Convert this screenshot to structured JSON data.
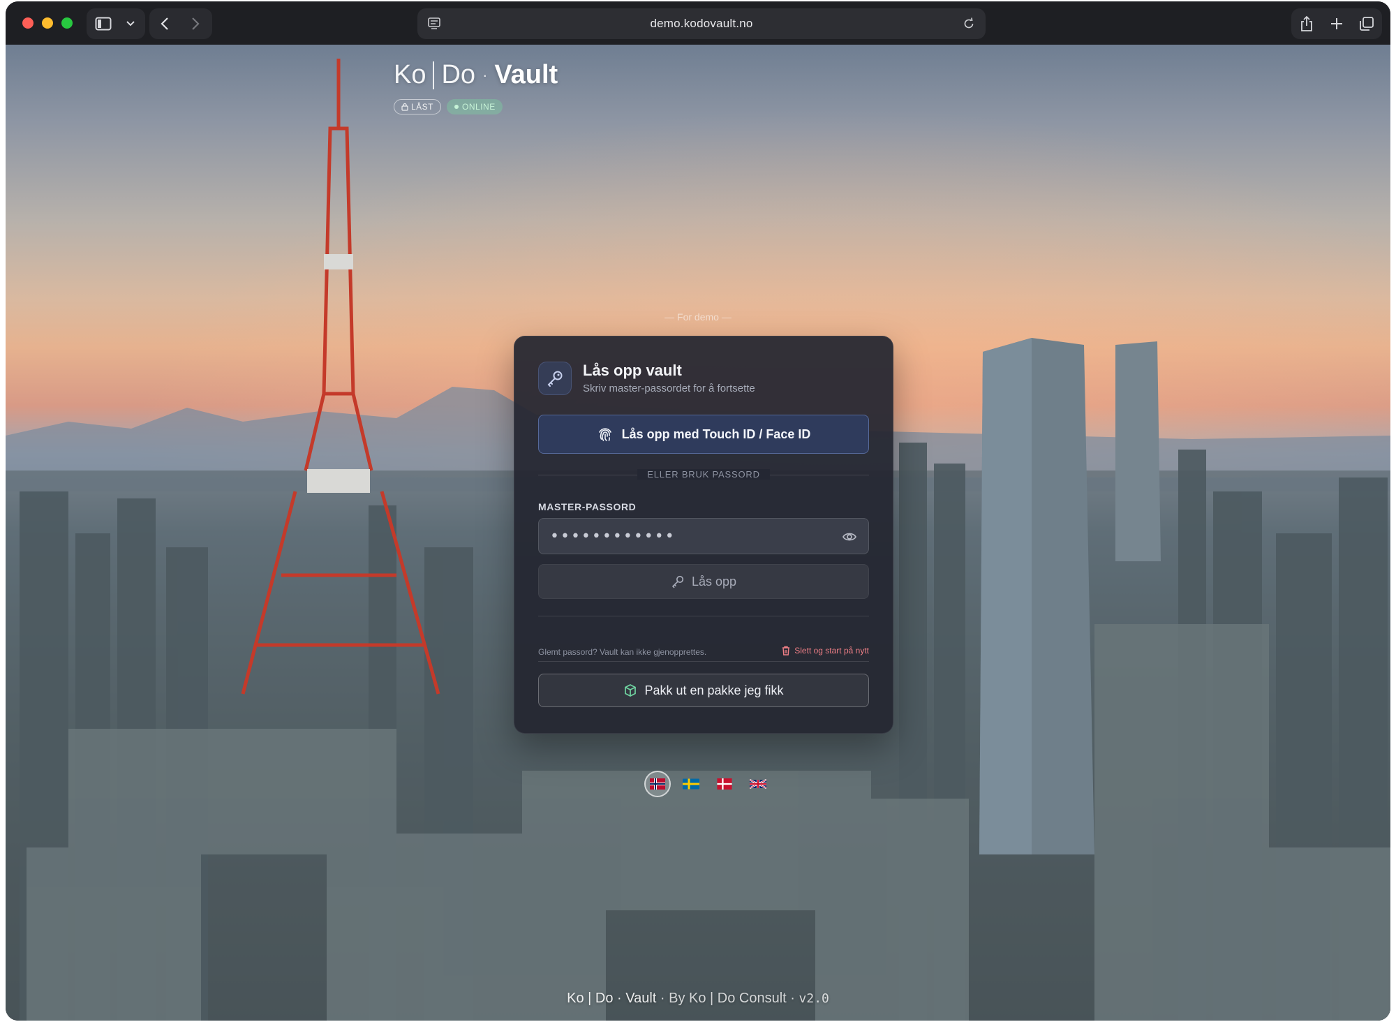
{
  "browser": {
    "url": "demo.kodovault.no",
    "icons": {
      "sidebar": "sidebar-icon",
      "chevron": "chevron-down-icon",
      "back": "chevron-left-icon",
      "forward": "chevron-right-icon",
      "page_settings": "page-settings-icon",
      "reload": "reload-icon",
      "share": "share-icon",
      "new_tab": "plus-icon",
      "tabs": "tab-overview-icon"
    }
  },
  "brand": {
    "part1": "Ko",
    "part2": "Do",
    "dot": "·",
    "part3": "Vault",
    "badge_locked": "LÅST",
    "badge_online": "ONLINE"
  },
  "demo_note": "— For demo —",
  "card": {
    "title": "Lås opp vault",
    "subtitle": "Skriv master-passordet for å fortsette",
    "biometric_button": "Lås opp med Touch ID / Face ID",
    "divider_label": "ELLER BRUK PASSORD",
    "field_label": "MASTER-PASSORD",
    "password_value": "••••••••••••",
    "unlock_button": "Lås opp",
    "forgot_text": "Glemt passord? Vault kan ikke gjenopprettes.",
    "reset_link": "Slett og start på nytt",
    "package_button": "Pakk ut en pakke jeg fikk"
  },
  "languages": [
    {
      "code": "no",
      "active": true
    },
    {
      "code": "se",
      "active": false
    },
    {
      "code": "dk",
      "active": false
    },
    {
      "code": "gb",
      "active": false
    }
  ],
  "footer": {
    "brand": "Ko | Do · Vault",
    "sep": "·",
    "by": "By Ko | Do Consult",
    "version": "v2.0"
  },
  "colors": {
    "accent": "#2f3b5c",
    "danger": "#ef7f86",
    "card_bg": "#232630"
  }
}
